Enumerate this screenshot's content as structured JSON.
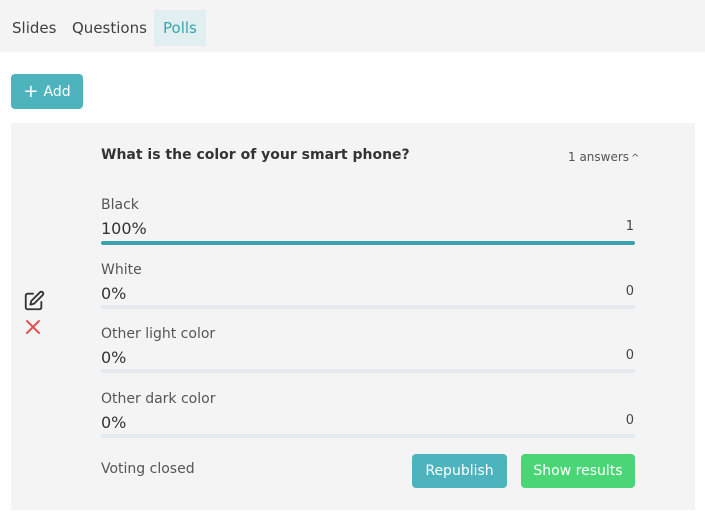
{
  "tabs": [
    {
      "label": "Slides"
    },
    {
      "label": "Questions"
    },
    {
      "label": "Polls"
    }
  ],
  "add_button": {
    "label": "Add"
  },
  "poll": {
    "question": "What is the color of your smart phone?",
    "answers_label": "1 answers",
    "options": [
      {
        "label": "Black",
        "percent": "100%",
        "count": "1",
        "fill": 1.0
      },
      {
        "label": "White",
        "percent": "0%",
        "count": "0",
        "fill": 0
      },
      {
        "label": "Other light color",
        "percent": "0%",
        "count": "0",
        "fill": 0
      },
      {
        "label": "Other dark color",
        "percent": "0%",
        "count": "0",
        "fill": 0
      }
    ],
    "status": "Voting closed",
    "republish_label": "Republish",
    "show_results_label": "Show results"
  },
  "icons": {
    "edit": "edit-icon",
    "delete": "close-icon",
    "add": "plus-icon",
    "toggle": "chevron-up-icon"
  },
  "colors": {
    "accent": "#4db3bd",
    "success": "#4ad676",
    "danger": "#e05252"
  }
}
